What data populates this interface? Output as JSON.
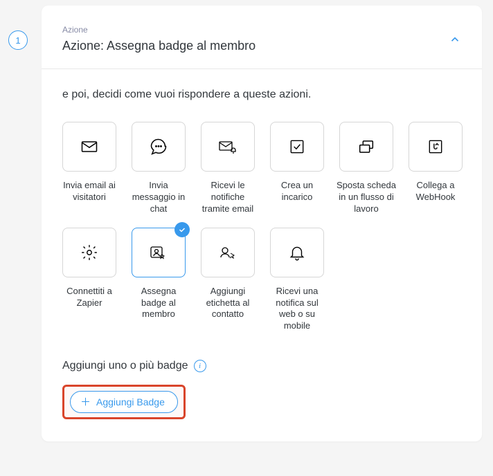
{
  "step_number": "1",
  "header": {
    "overline": "Azione",
    "title": "Azione: Assegna badge al membro"
  },
  "intro_text": "e poi, decidi come vuoi rispondere a queste azioni.",
  "options": [
    {
      "id": "email-visitors",
      "label": "Invia email ai visitatori",
      "selected": false
    },
    {
      "id": "chat-message",
      "label": "Invia messaggio in chat",
      "selected": false
    },
    {
      "id": "email-notify",
      "label": "Ricevi le notifiche tramite email",
      "selected": false
    },
    {
      "id": "create-task",
      "label": "Crea un incarico",
      "selected": false
    },
    {
      "id": "move-workflow",
      "label": "Sposta scheda in un flusso di lavoro",
      "selected": false
    },
    {
      "id": "webhook",
      "label": "Collega a WebHook",
      "selected": false
    },
    {
      "id": "zapier",
      "label": "Connettiti a Zapier",
      "selected": false
    },
    {
      "id": "assign-badge",
      "label": "Assegna badge al membro",
      "selected": true
    },
    {
      "id": "add-label",
      "label": "Aggiungi etichetta al contatto",
      "selected": false
    },
    {
      "id": "web-mobile-notify",
      "label": "Ricevi una notifica sul web o su mobile",
      "selected": false
    }
  ],
  "subtitle": "Aggiungi uno o più badge",
  "add_button_label": "Aggiungi Badge"
}
